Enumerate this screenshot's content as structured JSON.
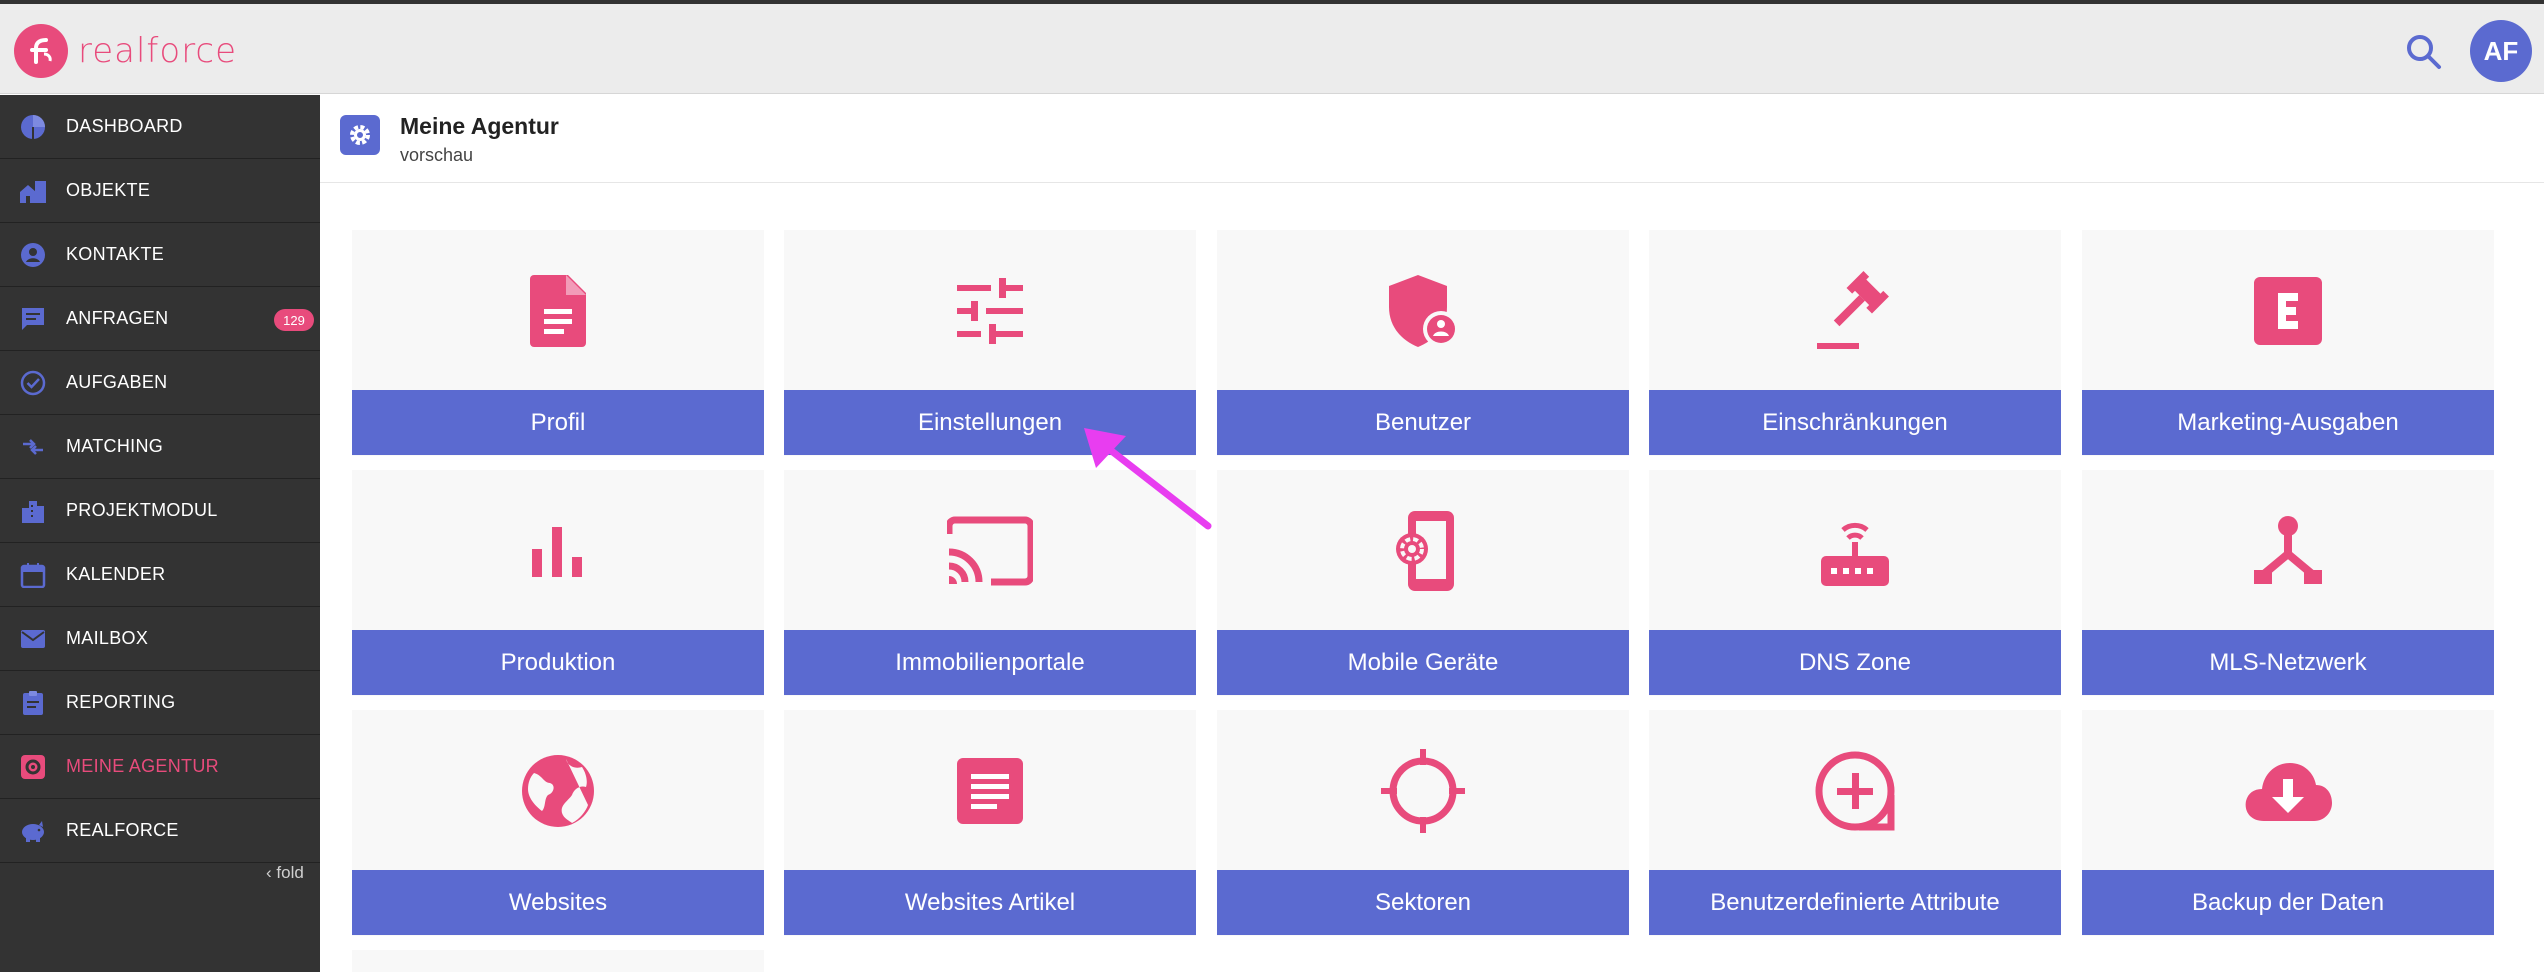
{
  "app": {
    "brand": "realforce",
    "avatar_initials": "AF",
    "accent": "#e84b7c",
    "primary": "#5b6ad0"
  },
  "sidebar": {
    "items": [
      {
        "label": "DASHBOARD",
        "icon": "pie-chart-icon"
      },
      {
        "label": "OBJEKTE",
        "icon": "buildings-icon"
      },
      {
        "label": "KONTAKTE",
        "icon": "account-circle-icon"
      },
      {
        "label": "ANFRAGEN",
        "icon": "chat-icon",
        "badge": "129"
      },
      {
        "label": "AUFGABEN",
        "icon": "check-circle-icon"
      },
      {
        "label": "MATCHING",
        "icon": "swap-arrows-icon"
      },
      {
        "label": "PROJEKTMODUL",
        "icon": "city-icon"
      },
      {
        "label": "KALENDER",
        "icon": "calendar-icon"
      },
      {
        "label": "MAILBOX",
        "icon": "mail-icon"
      },
      {
        "label": "REPORTING",
        "icon": "clipboard-icon"
      },
      {
        "label": "MEINE AGENTUR",
        "icon": "gear-box-icon",
        "active": true
      },
      {
        "label": "REALFORCE",
        "icon": "piggy-bank-icon"
      }
    ],
    "fold_label": "fold"
  },
  "header": {
    "title": "Meine Agentur",
    "subtitle": "vorschau"
  },
  "tiles": [
    {
      "label": "Profil",
      "icon": "document-icon"
    },
    {
      "label": "Einstellungen",
      "icon": "sliders-icon"
    },
    {
      "label": "Benutzer",
      "icon": "shield-user-icon"
    },
    {
      "label": "Einschränkungen",
      "icon": "gavel-icon"
    },
    {
      "label": "Marketing-Ausgaben",
      "icon": "letter-e-icon"
    },
    {
      "label": "Produktion",
      "icon": "bar-chart-icon"
    },
    {
      "label": "Immobilienportale",
      "icon": "cast-icon"
    },
    {
      "label": "Mobile Geräte",
      "icon": "phone-settings-icon"
    },
    {
      "label": "DNS Zone",
      "icon": "router-icon"
    },
    {
      "label": "MLS-Netzwerk",
      "icon": "network-icon"
    },
    {
      "label": "Websites",
      "icon": "globe-icon"
    },
    {
      "label": "Websites Artikel",
      "icon": "article-icon"
    },
    {
      "label": "Sektoren",
      "icon": "crosshair-icon"
    },
    {
      "label": "Benutzerdefinierte Attribute",
      "icon": "add-circle-icon"
    },
    {
      "label": "Backup der Daten",
      "icon": "cloud-download-icon"
    }
  ]
}
